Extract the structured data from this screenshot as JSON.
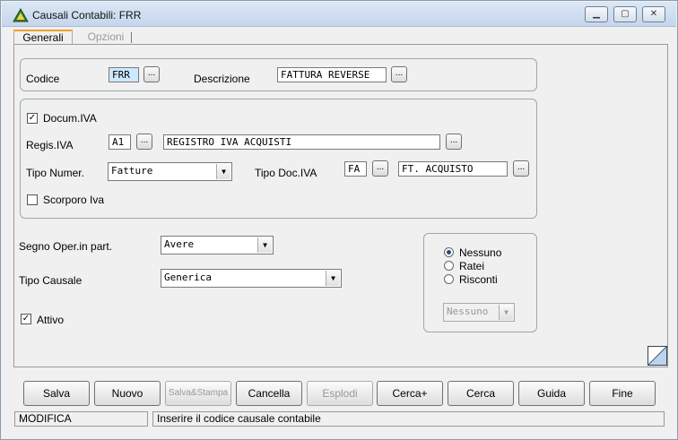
{
  "window": {
    "title": "Causali Contabili: FRR"
  },
  "tabs": [
    {
      "label": "Generali"
    },
    {
      "label": "Opzioni"
    }
  ],
  "form": {
    "codice_label": "Codice",
    "codice_value": "FRR",
    "descrizione_label": "Descrizione",
    "descrizione_value": "FATTURA REVERSE",
    "docum_iva_label": "Docum.IVA",
    "docum_iva_checked": true,
    "regis_iva_label": "Regis.IVA",
    "regis_iva_code": "A1",
    "regis_iva_desc": "REGISTRO IVA ACQUISTI",
    "tipo_numer_label": "Tipo Numer.",
    "tipo_numer_value": "Fatture",
    "tipo_doc_iva_label": "Tipo Doc.IVA",
    "tipo_doc_iva_code": "FA",
    "tipo_doc_iva_desc": "FT. ACQUISTO",
    "scorporo_label": "Scorporo Iva",
    "scorporo_checked": false,
    "segno_label": "Segno Oper.in part.",
    "segno_value": "Avere",
    "tipo_causale_label": "Tipo Causale",
    "tipo_causale_value": "Generica",
    "attivo_label": "Attivo",
    "attivo_checked": true,
    "radio_options": [
      "Nessuno",
      "Ratei",
      "Risconti"
    ],
    "radio_selected": "Nessuno",
    "ratei_combo_value": "Nessuno"
  },
  "dots_label": "...",
  "buttons": [
    {
      "id": "salva",
      "label": "Salva",
      "disabled": false
    },
    {
      "id": "nuovo",
      "label": "Nuovo",
      "disabled": false
    },
    {
      "id": "salva-stampa",
      "label": "Salva&Stampa",
      "disabled": true
    },
    {
      "id": "cancella",
      "label": "Cancella",
      "disabled": false
    },
    {
      "id": "esplodi",
      "label": "Esplodi",
      "disabled": true
    },
    {
      "id": "cerca-plus",
      "label": "Cerca+",
      "disabled": false
    },
    {
      "id": "cerca",
      "label": "Cerca",
      "disabled": false
    },
    {
      "id": "guida",
      "label": "Guida",
      "disabled": false
    },
    {
      "id": "fine",
      "label": "Fine",
      "disabled": false
    }
  ],
  "status": {
    "mode": "MODIFICA",
    "message": "Inserire il codice causale contabile"
  },
  "colors": {
    "tab_accent": "#f1a12d",
    "selected_field": "#cde8ff",
    "titlebar": "#c5d6ec"
  }
}
